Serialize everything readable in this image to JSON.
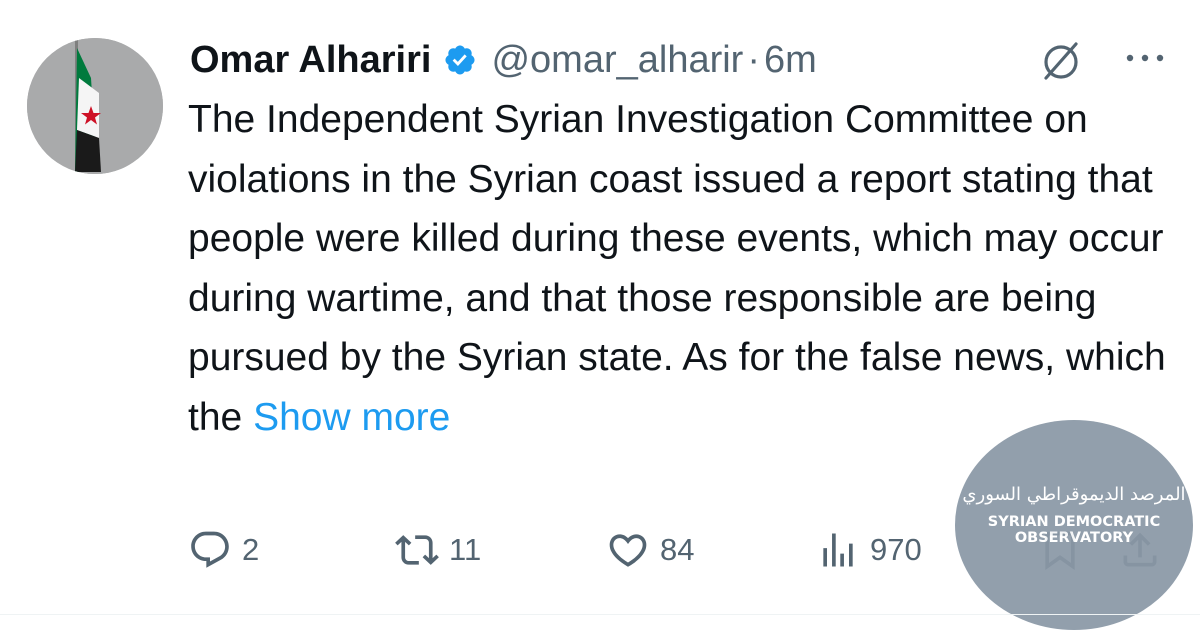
{
  "tweet": {
    "author_name": "Omar Alhariri",
    "handle": "@omar_alharir",
    "separator": "·",
    "time": "6m",
    "text": "The Independent Syrian Investigation Committee on violations in the Syrian coast issued a report stating that people were killed during these events, which may occur during wartime, and that those responsible are being pursued by the Syrian state. As for the false news, which the ",
    "show_more": "Show more",
    "icons": {
      "verified": "verified-badge-icon",
      "grok": "grok-icon",
      "more": "more-options-icon"
    }
  },
  "actions": {
    "replies": {
      "icon": "reply-icon",
      "count": "2"
    },
    "reposts": {
      "icon": "repost-icon",
      "count": "11"
    },
    "likes": {
      "icon": "like-icon",
      "count": "84"
    },
    "views": {
      "icon": "views-icon",
      "count": "970"
    },
    "bookmark": {
      "icon": "bookmark-icon"
    },
    "share": {
      "icon": "share-icon"
    }
  },
  "watermark": {
    "arabic": "المرصد الديموقراطي السوري",
    "english": "SYRIAN DEMOCRATIC OBSERVATORY"
  },
  "colors": {
    "text": "#0f1419",
    "secondary": "#536471",
    "link": "#1d9bf0",
    "verified": "#1d9bf0",
    "flag_green": "#007a3d",
    "flag_red": "#ce1126"
  }
}
